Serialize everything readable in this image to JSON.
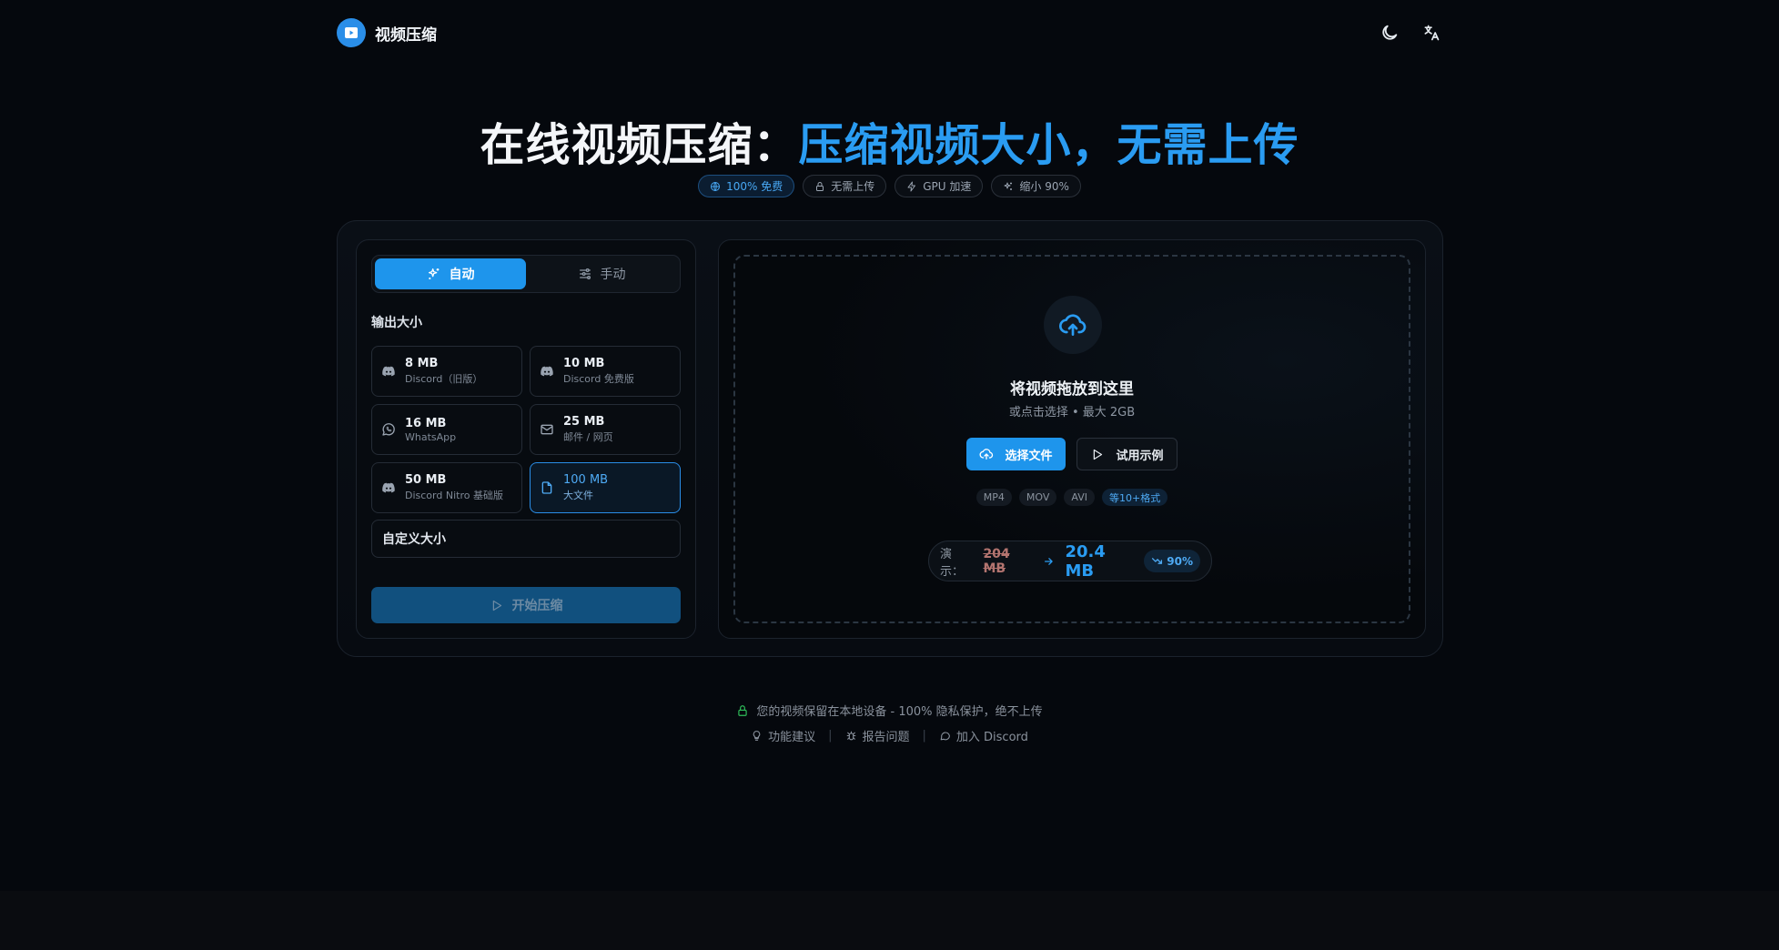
{
  "header": {
    "brand_name": "视频压缩",
    "theme_icon": "moon-icon",
    "lang_icon": "translate-icon"
  },
  "hero": {
    "title_plain": "在线视频压缩：",
    "title_accent": "压缩视频大小，无需上传",
    "pills": [
      {
        "label": "100% 免费",
        "icon": "globe-icon"
      },
      {
        "label": "无需上传",
        "icon": "lock-icon"
      },
      {
        "label": "GPU 加速",
        "icon": "bolt-icon"
      },
      {
        "label": "缩小 90%",
        "icon": "sparkles-icon"
      }
    ]
  },
  "settings": {
    "modes": {
      "auto": "自动",
      "manual": "手动"
    },
    "output_size_label": "输出大小",
    "sizes": [
      {
        "value": "8 MB",
        "sub": "Discord（旧版）",
        "icon": "discord-icon"
      },
      {
        "value": "10 MB",
        "sub": "Discord 免费版",
        "icon": "discord-icon"
      },
      {
        "value": "16 MB",
        "sub": "WhatsApp",
        "icon": "whatsapp-icon"
      },
      {
        "value": "25 MB",
        "sub": "邮件 / 网页",
        "icon": "mail-icon"
      },
      {
        "value": "50 MB",
        "sub": "Discord Nitro 基础版",
        "icon": "discord-icon"
      },
      {
        "value": "100 MB",
        "sub": "大文件",
        "icon": "file-icon"
      }
    ],
    "selected_size": "100 MB",
    "custom_size_label": "自定义大小",
    "start_label": "开始压缩"
  },
  "dropzone": {
    "title": "将视频拖放到这里",
    "subtitle": "或点击选择 • 最大 2GB",
    "choose_label": "选择文件",
    "sample_label": "试用示例",
    "formats": [
      "MP4",
      "MOV",
      "AVI",
      "等10+格式"
    ],
    "demo": {
      "label": "演示：",
      "from": "204 MB",
      "to": "20.4 MB",
      "reduction": "90%"
    }
  },
  "footer": {
    "privacy": "您的视频保留在本地设备 - 100% 隐私保护，绝不上传",
    "links": [
      {
        "label": "功能建议",
        "icon": "lightbulb-icon"
      },
      {
        "label": "报告问题",
        "icon": "bug-icon"
      },
      {
        "label": "加入 Discord",
        "icon": "chat-icon"
      }
    ]
  },
  "colors": {
    "accent": "#1e95ec",
    "background": "#05080d",
    "privacy_green": "#2fbf5a"
  }
}
